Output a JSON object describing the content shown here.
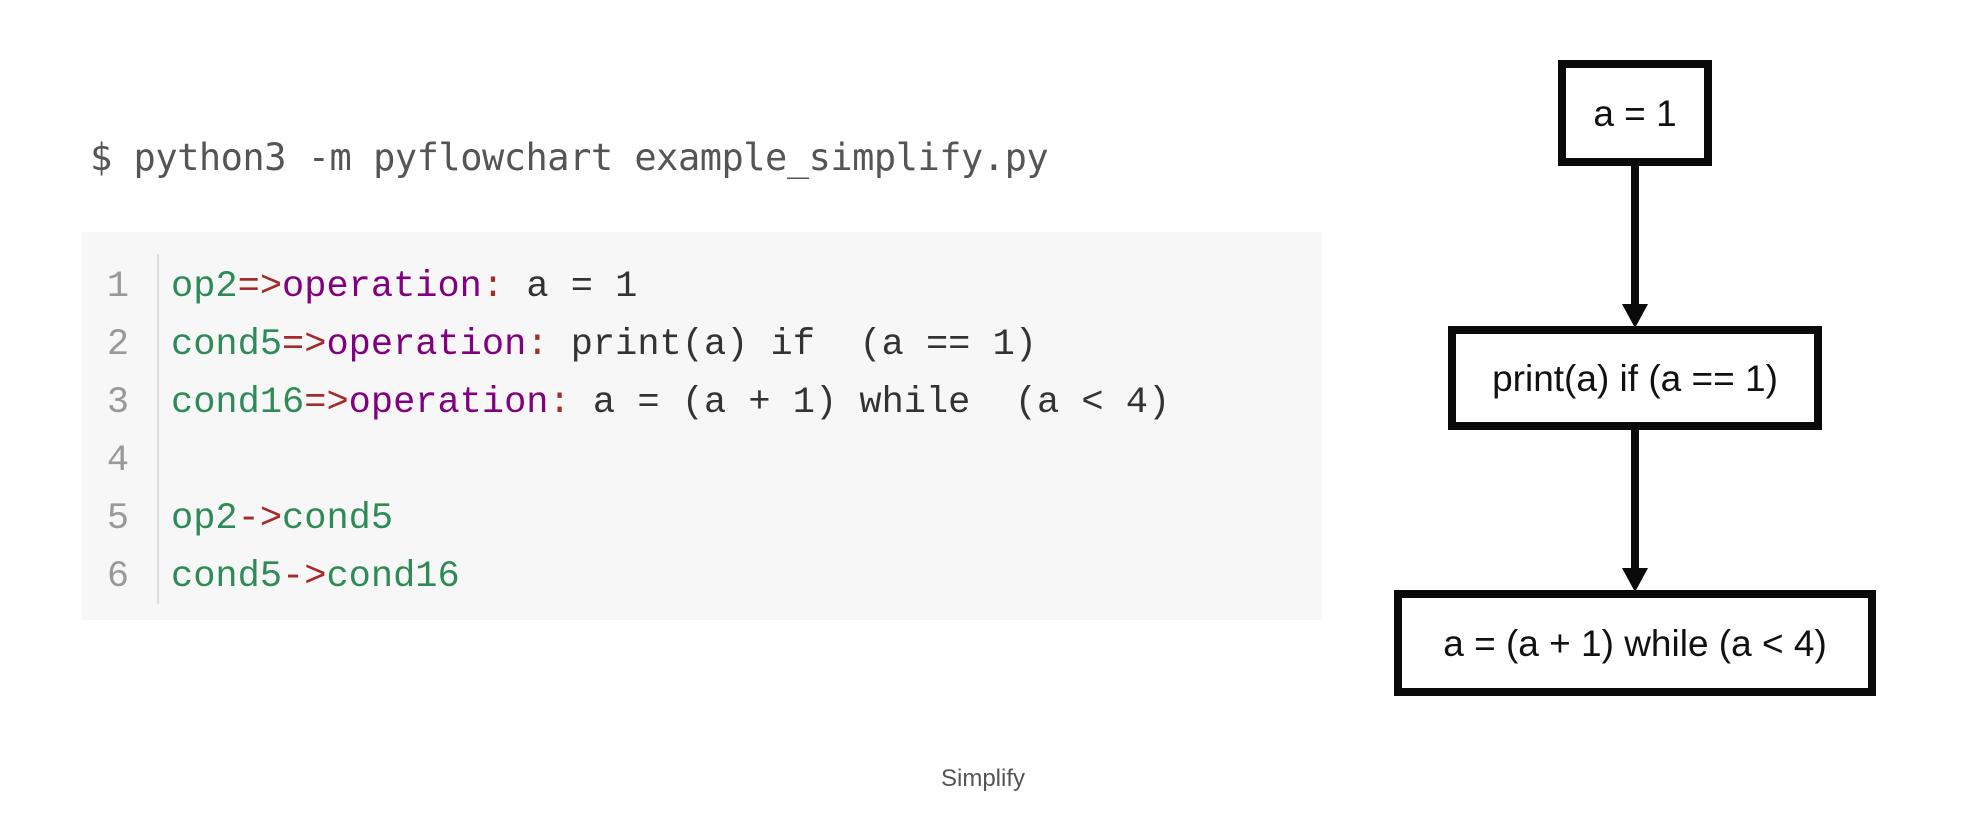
{
  "command": {
    "text": "$ python3 -m pyflowchart example_simplify.py"
  },
  "code_block": {
    "lines": [
      {
        "number": "1",
        "tokens": [
          {
            "type": "name",
            "text": "op2"
          },
          {
            "type": "op",
            "text": "=>"
          },
          {
            "type": "kw",
            "text": "operation"
          },
          {
            "type": "op",
            "text": ":"
          },
          {
            "type": "text",
            "text": " a = 1"
          }
        ]
      },
      {
        "number": "2",
        "tokens": [
          {
            "type": "name",
            "text": "cond5"
          },
          {
            "type": "op",
            "text": "=>"
          },
          {
            "type": "kw",
            "text": "operation"
          },
          {
            "type": "op",
            "text": ":"
          },
          {
            "type": "text",
            "text": " print(a) if  (a == 1)"
          }
        ]
      },
      {
        "number": "3",
        "tokens": [
          {
            "type": "name",
            "text": "cond16"
          },
          {
            "type": "op",
            "text": "=>"
          },
          {
            "type": "kw",
            "text": "operation"
          },
          {
            "type": "op",
            "text": ":"
          },
          {
            "type": "text",
            "text": " a = (a + 1) while  (a < 4)"
          }
        ]
      },
      {
        "number": "4",
        "tokens": []
      },
      {
        "number": "5",
        "tokens": [
          {
            "type": "name",
            "text": "op2"
          },
          {
            "type": "op",
            "text": "->"
          },
          {
            "type": "name",
            "text": "cond5"
          }
        ]
      },
      {
        "number": "6",
        "tokens": [
          {
            "type": "name",
            "text": "cond5"
          },
          {
            "type": "op",
            "text": "->"
          },
          {
            "type": "name",
            "text": "cond16"
          }
        ]
      }
    ],
    "colors": {
      "name": "#2e8b57",
      "operator": "#a52a2a",
      "keyword": "#800080",
      "text": "#333333",
      "line_number": "#999999",
      "background": "#f7f7f7"
    }
  },
  "flowchart": {
    "nodes": [
      {
        "id": "op2",
        "label": "a = 1"
      },
      {
        "id": "cond5",
        "label": "print(a) if (a == 1)"
      },
      {
        "id": "cond16",
        "label": "a = (a + 1) while (a < 4)"
      }
    ],
    "edges": [
      {
        "from": "op2",
        "to": "cond5"
      },
      {
        "from": "cond5",
        "to": "cond16"
      }
    ]
  },
  "caption": "Simplify"
}
